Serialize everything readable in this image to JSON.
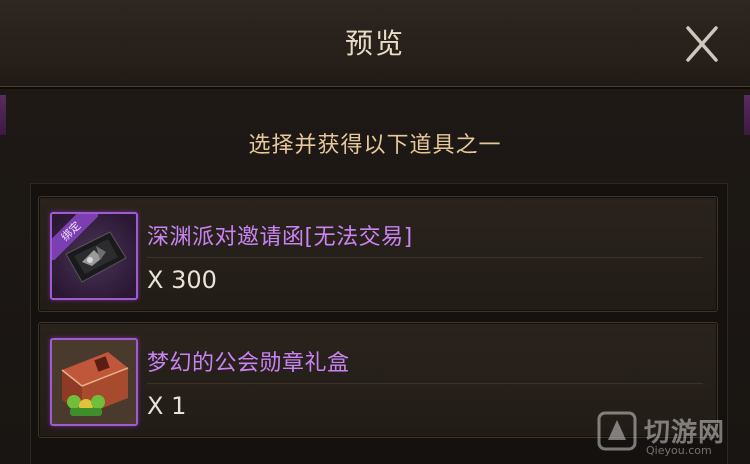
{
  "dialog": {
    "title": "预览",
    "subtitle": "选择并获得以下道具之一"
  },
  "items": [
    {
      "name": "深渊派对邀请函[无法交易]",
      "quantity": "X 300",
      "badge": "绑定",
      "icon": "abyss-invitation-card-icon",
      "rarity_color": "#a25ad0"
    },
    {
      "name": "梦幻的公会勋章礼盒",
      "quantity": "X 1",
      "icon": "guild-medal-gift-box-icon",
      "rarity_color": "#a25ad0"
    }
  ],
  "watermark": {
    "text": "切游网",
    "url": "Qieyou.com"
  }
}
